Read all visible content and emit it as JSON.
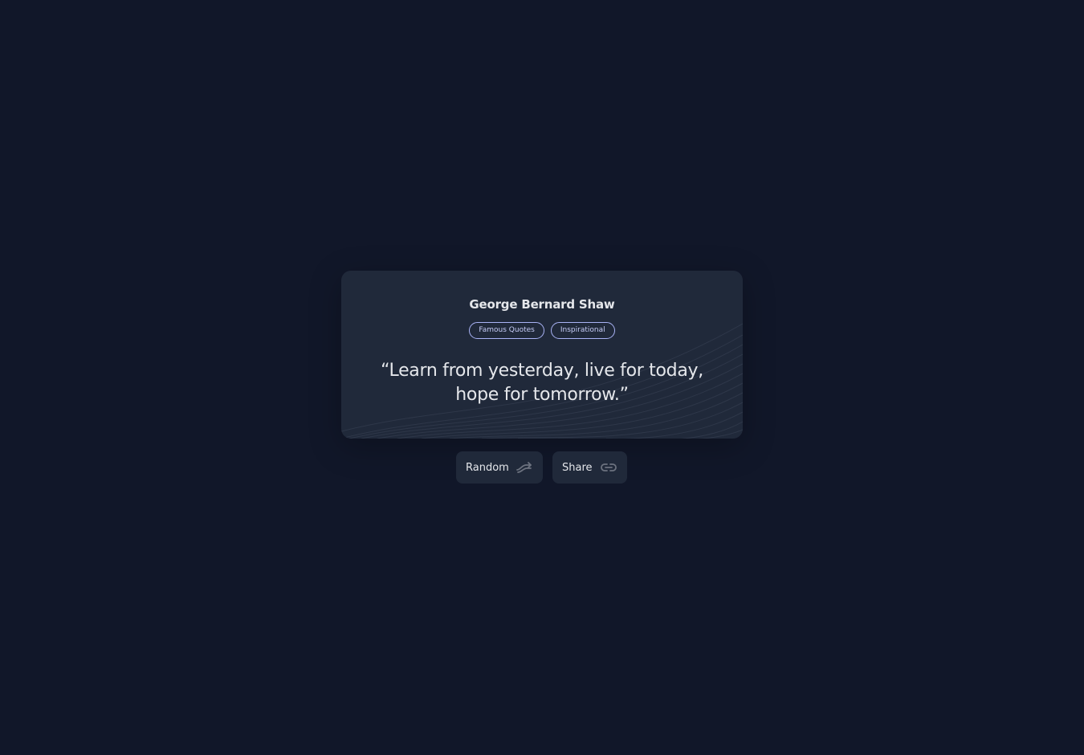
{
  "quote_card": {
    "author": "George Bernard Shaw",
    "tags": [
      "Famous Quotes",
      "Inspirational"
    ],
    "text": "“Learn from yesterday, live for today, hope for tomorrow.”"
  },
  "actions": {
    "random_label": "Random",
    "random_icon": "shuffle-arrows-icon",
    "share_label": "Share",
    "share_icon": "link-icon"
  },
  "colors": {
    "background": "#111729",
    "card": "#20293a",
    "text": "#e5e7eb",
    "tag_accent": "#a9b3f5",
    "icon": "#6c727f"
  }
}
